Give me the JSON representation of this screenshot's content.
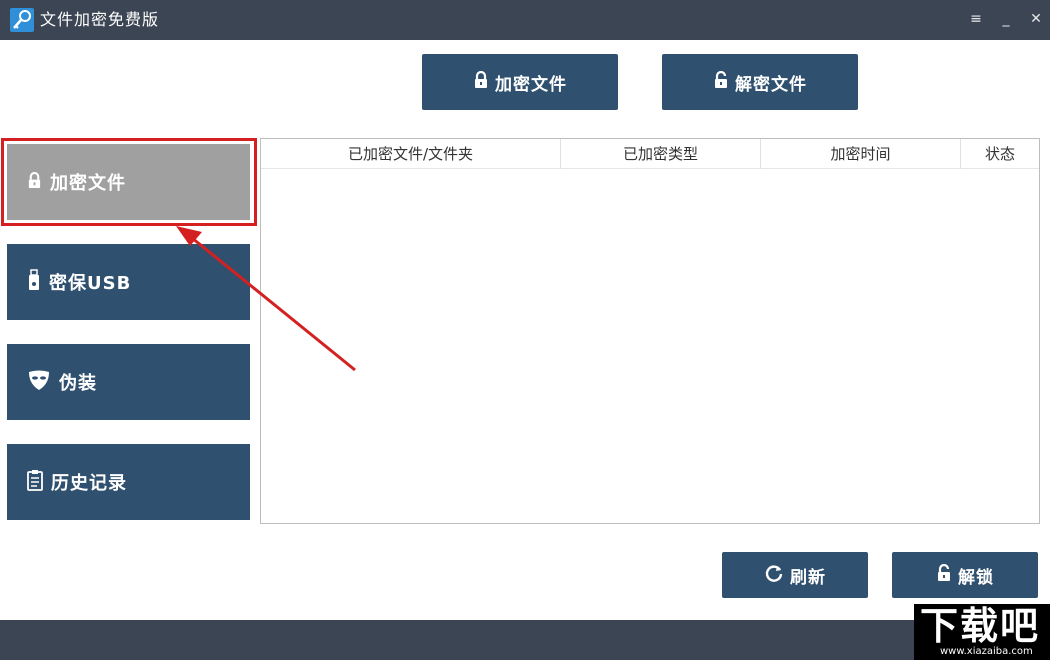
{
  "window": {
    "title": "文件加密免费版",
    "menu_glyph": "≡",
    "min_glyph": "_",
    "close_glyph": "✕"
  },
  "top_actions": {
    "encrypt_label": "加密文件",
    "decrypt_label": "解密文件"
  },
  "sidebar": {
    "items": [
      {
        "label": "加密文件",
        "icon": "lock-icon",
        "active": true
      },
      {
        "label": "密保USB",
        "icon": "usb-icon",
        "active": false
      },
      {
        "label": "伪装",
        "icon": "mask-icon",
        "active": false
      },
      {
        "label": "历史记录",
        "icon": "clipboard-icon",
        "active": false
      }
    ]
  },
  "table": {
    "columns": [
      "已加密文件/文件夹",
      "已加密类型",
      "加密时间",
      "状态"
    ],
    "rows": []
  },
  "bottom_actions": {
    "refresh_label": "刷新",
    "unlock_label": "解锁"
  },
  "watermark": {
    "big_text": "下载吧",
    "small_text": "www.xiazaiba.com"
  },
  "colors": {
    "titlebar": "#3b4553",
    "button": "#2f506e",
    "active_item": "#a0a0a0",
    "highlight": "#d42020"
  }
}
